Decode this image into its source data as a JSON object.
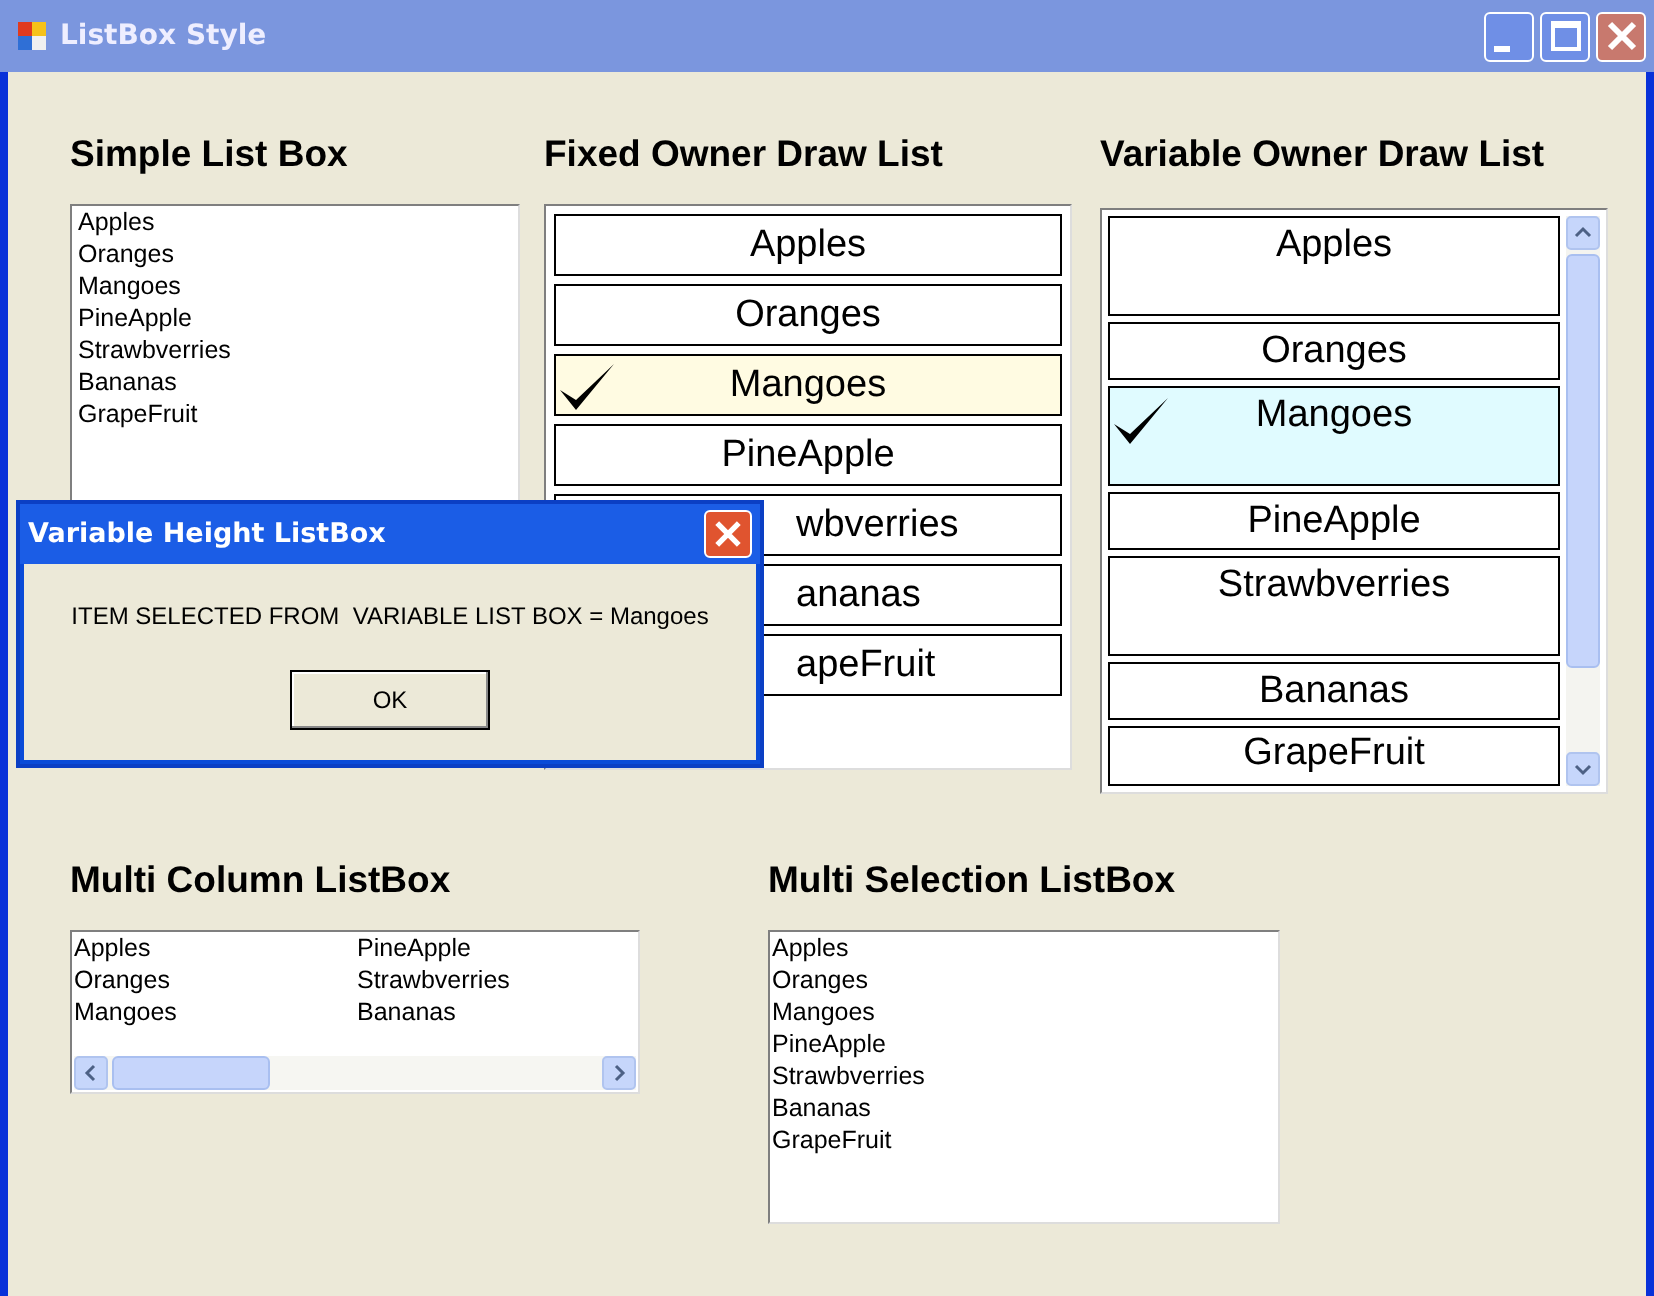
{
  "window": {
    "title": "ListBox Style"
  },
  "simple_list": {
    "title": "Simple List Box",
    "items": [
      "Apples",
      "Oranges",
      "Mangoes",
      "PineApple",
      "Strawbverries",
      "Bananas",
      "GrapeFruit"
    ]
  },
  "fixed_list": {
    "title": "Fixed Owner Draw List",
    "items": [
      {
        "label": "Apples",
        "selected": false,
        "kind": "whole"
      },
      {
        "label": "Oranges",
        "selected": false,
        "kind": "whole"
      },
      {
        "label": "Mangoes",
        "selected": true,
        "kind": "whole"
      },
      {
        "label": "PineApple",
        "selected": false,
        "kind": "whole"
      },
      {
        "label": "wbverries",
        "selected": false,
        "kind": "partial"
      },
      {
        "label": "ananas",
        "selected": false,
        "kind": "partial"
      },
      {
        "label": "apeFruit",
        "selected": false,
        "kind": "partial"
      }
    ]
  },
  "variable_list": {
    "title": "Variable Owner Draw  List",
    "items": [
      {
        "label": "Apples",
        "selected": false,
        "kind": "tall"
      },
      {
        "label": "Oranges",
        "selected": false,
        "kind": "short"
      },
      {
        "label": "Mangoes",
        "selected": true,
        "kind": "tall"
      },
      {
        "label": "PineApple",
        "selected": false,
        "kind": "short"
      },
      {
        "label": "Strawbverries",
        "selected": false,
        "kind": "tall"
      },
      {
        "label": "Bananas",
        "selected": false,
        "kind": "short"
      },
      {
        "label": "GrapeFruit",
        "selected": false,
        "kind": "short"
      }
    ]
  },
  "multi_column_list": {
    "title": "Multi Column ListBox",
    "columns": [
      [
        "Apples",
        "Oranges",
        "Mangoes"
      ],
      [
        "PineApple",
        "Strawbverries",
        "Bananas"
      ]
    ]
  },
  "multi_selection_list": {
    "title": "Multi Selection ListBox",
    "items": [
      "Apples",
      "Oranges",
      "Mangoes",
      "PineApple",
      "Strawbverries",
      "Bananas",
      "GrapeFruit"
    ]
  },
  "dialog": {
    "title": "Variable Height ListBox",
    "message": "ITEM SELECTED FROM  VARIABLE LIST BOX = Mangoes",
    "button": "OK"
  }
}
